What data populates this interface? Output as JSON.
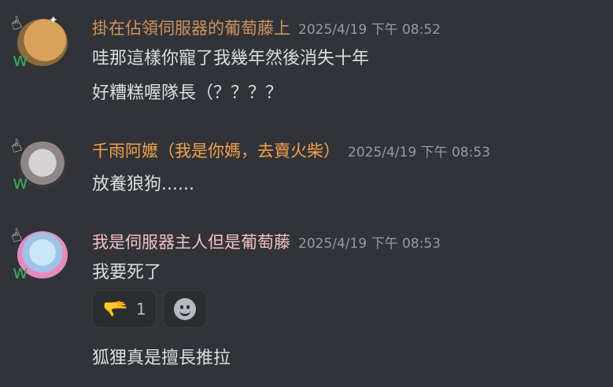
{
  "colors": {
    "background": "#313338",
    "user1": "#d0925d",
    "user2": "#f0a24b",
    "user3": "#f2c0c7",
    "text": "#dbdee1",
    "timestamp": "#949ba4"
  },
  "messages": [
    {
      "username": "掛在佔領伺服器的葡萄藤上",
      "timestamp": "2025/4/19 下午 08:52",
      "lines": [
        "哇那這樣你寵了我幾年然後消失十年",
        "好糟糕喔隊長（？？？？"
      ]
    },
    {
      "username": "千雨阿嬤（我是你媽，去賣火柴）",
      "timestamp": "2025/4/19 下午 08:53",
      "lines": [
        "放養狼狗......"
      ]
    },
    {
      "username": "我是伺服器主人但是葡萄藤",
      "timestamp": "2025/4/19 下午 08:53",
      "lines": [
        "我要死了",
        "狐狸真是擅長推拉"
      ],
      "reactions": [
        {
          "emoji": "🫳",
          "count": "1"
        }
      ],
      "add_reaction_icon": "smile-plus-icon"
    }
  ]
}
